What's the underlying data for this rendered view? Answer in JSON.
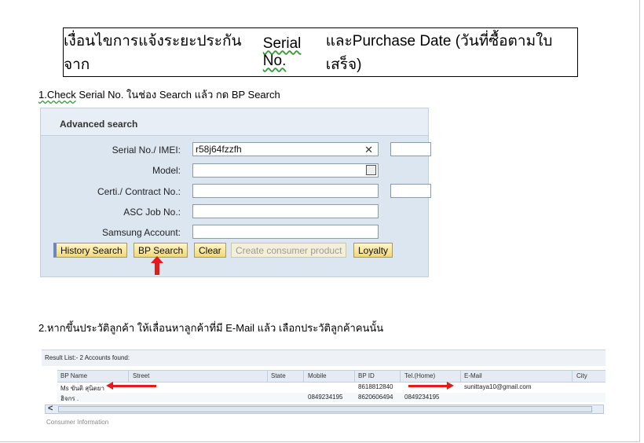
{
  "title": {
    "prefix": "เงื่อนไขการแจ้งระยะประกัน จาก ",
    "serial": "Serial No.",
    "suffix": " และPurchase Date (วันที่ซื้อตามใบเสร็จ)"
  },
  "step1": {
    "check": "1.Check",
    "rest": "  Serial No. ในช่อง Search แล้ว กด BP Search"
  },
  "advanced_search": {
    "title": "Advanced search",
    "fields": [
      {
        "label": "Serial No./ IMEI:",
        "value": "r58j64fzzfh"
      },
      {
        "label": "Model:",
        "value": ""
      },
      {
        "label": "Certi./ Contract No.:",
        "value": ""
      },
      {
        "label": "ASC Job No.:",
        "value": ""
      },
      {
        "label": "Samsung Account:",
        "value": ""
      }
    ],
    "clear_glyph": "✕",
    "buttons": {
      "history": "History Search",
      "bp": "BP Search",
      "clear": "Clear",
      "create": "Create consumer product",
      "loyalty": "Loyalty"
    }
  },
  "step2": "2.หากขึ้นประวัติลูกค้า ให้เลื่อนหาลูกค้าที่มี E-Mail แล้ว เลือกประวัติลูกค้าคนนั้น",
  "result": {
    "header": "Result List:- 2 Accounts found:",
    "columns": [
      "BP Name",
      "Street",
      "State",
      "Mobile",
      "BP ID",
      "Tel.(Home)",
      "E-Mail",
      "City"
    ],
    "rows": [
      {
        "name": "Ms ขันติ สุนิตยา",
        "street": "",
        "state": "",
        "mobile": "",
        "bpid": "8618812840",
        "tel": "",
        "email": "sunittaya10@gmail.com",
        "city": ""
      },
      {
        "name": "ฮิจกร .",
        "street": "",
        "state": "",
        "mobile": "0849234195",
        "bpid": "8620606494",
        "tel": "0849234195",
        "email": "",
        "city": ""
      }
    ],
    "scroll_left": "<",
    "footer_cut": "Consumer Information"
  }
}
